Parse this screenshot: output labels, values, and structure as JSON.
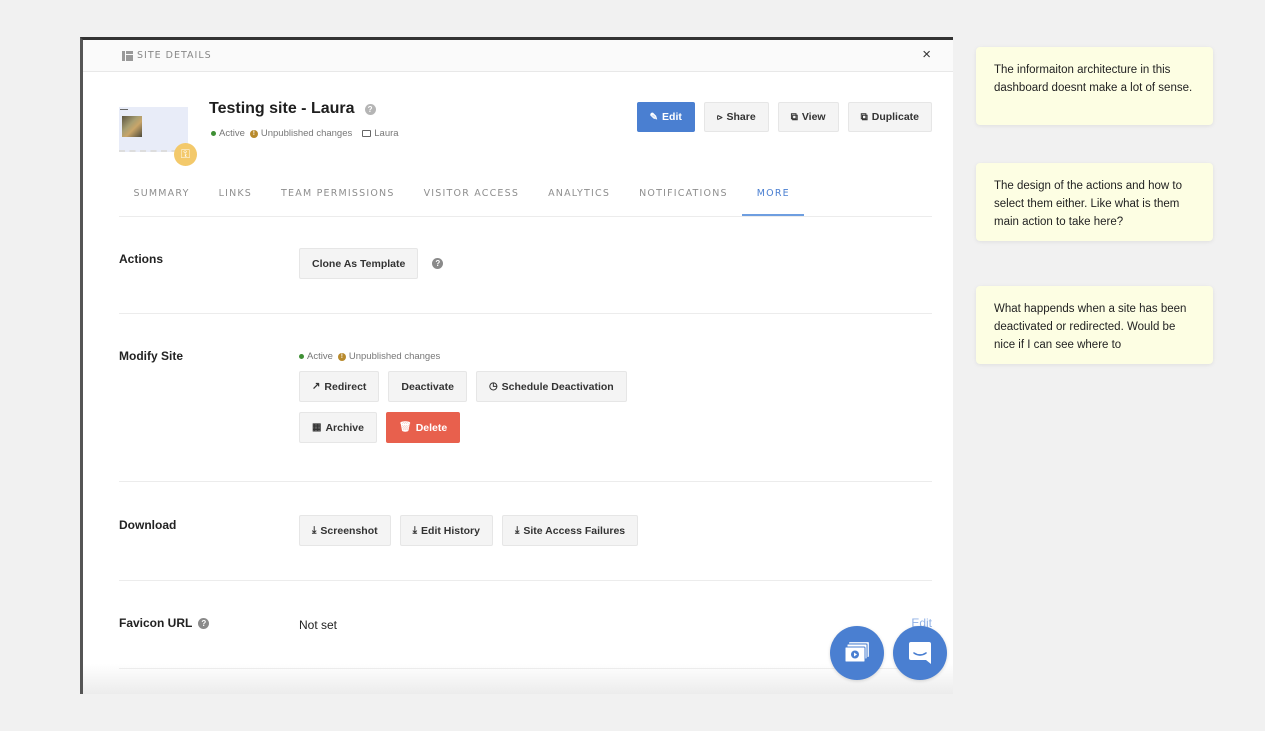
{
  "modal": {
    "header_title": "SITE DETAILS",
    "close_label": "×"
  },
  "site": {
    "title": "Testing site - Laura",
    "status_active": "Active",
    "status_unpublished": "Unpublished changes",
    "folder": "Laura"
  },
  "top_actions": {
    "edit": "Edit",
    "share": "Share",
    "view": "View",
    "duplicate": "Duplicate"
  },
  "tabs": [
    {
      "label": "SUMMARY"
    },
    {
      "label": "LINKS"
    },
    {
      "label": "TEAM PERMISSIONS"
    },
    {
      "label": "VISITOR ACCESS"
    },
    {
      "label": "ANALYTICS"
    },
    {
      "label": "NOTIFICATIONS"
    },
    {
      "label": "MORE",
      "active": true
    }
  ],
  "sections": {
    "actions": {
      "label": "Actions",
      "clone_template": "Clone As Template"
    },
    "modify": {
      "label": "Modify Site",
      "status_active": "Active",
      "status_unpublished": "Unpublished changes",
      "redirect": "Redirect",
      "deactivate": "Deactivate",
      "schedule_deactivation": "Schedule Deactivation",
      "archive": "Archive",
      "delete": "Delete"
    },
    "download": {
      "label": "Download",
      "screenshot": "Screenshot",
      "edit_history": "Edit History",
      "site_access_failures": "Site Access Failures"
    },
    "favicon": {
      "label": "Favicon URL",
      "value": "Not set",
      "edit": "Edit"
    }
  },
  "colors": {
    "primary": "#4a7fd1",
    "danger": "#e8604d",
    "active_green": "#3f8f34",
    "warning": "#b88a2c",
    "note_bg": "#fdfee3"
  },
  "notes": [
    {
      "text": "The informaiton architecture in this dashboard doesnt make a lot of sense."
    },
    {
      "text": "The design of the actions and how to select them either. Like what is them main action to take here?"
    },
    {
      "text": "What happends when a site has been deactivated or redirected. Would be nice if I can see where to"
    }
  ]
}
